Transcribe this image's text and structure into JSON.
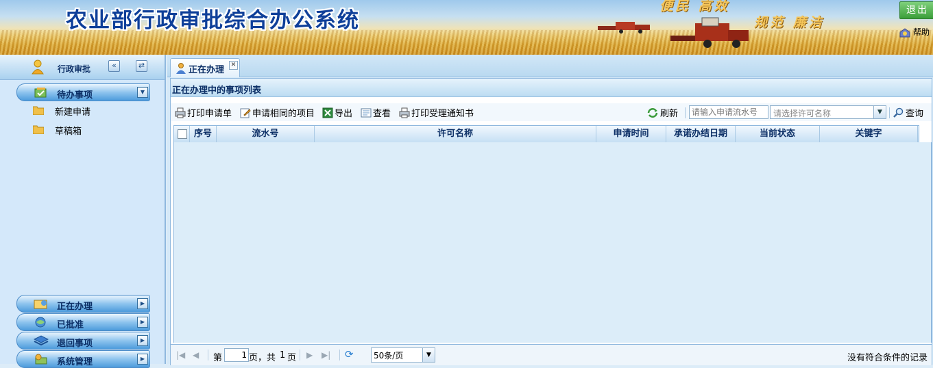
{
  "header": {
    "system_title": "农业部行政审批综合办公系统",
    "slogan_1": "便民 高效",
    "slogan_2": "规范 廉洁",
    "logout_label": "退出",
    "help_label": "帮助"
  },
  "sidebar": {
    "title": "行政审批",
    "collapse_icon": "«",
    "switch_icon": "⇄",
    "sections": [
      {
        "label": "待办事项",
        "icon": "pending-icon",
        "arrow": "▼"
      },
      {
        "label": "正在办理",
        "icon": "processing-icon",
        "arrow": "▶"
      },
      {
        "label": "已批准",
        "icon": "approved-icon",
        "arrow": "▶"
      },
      {
        "label": "退回事项",
        "icon": "returned-icon",
        "arrow": "▶"
      },
      {
        "label": "系统管理",
        "icon": "system-icon",
        "arrow": "▶"
      }
    ],
    "pending_items": [
      {
        "label": "新建申请",
        "icon": "folder-icon"
      },
      {
        "label": "草稿箱",
        "icon": "folder-icon"
      }
    ]
  },
  "main": {
    "tab": {
      "label": "正在办理",
      "close": "✕"
    },
    "panel_title": "正在办理中的事项列表",
    "toolbar": {
      "print_form": "打印申请单",
      "same_project": "申请相同的项目",
      "export": "导出",
      "view": "查看",
      "print_notice": "打印受理通知书",
      "refresh": "刷新",
      "search_placeholder": "请输入申请流水号",
      "permit_placeholder": "请选择许可名称",
      "query": "查询"
    },
    "columns": [
      "序号",
      "流水号",
      "许可名称",
      "申请时间",
      "承诺办结日期",
      "当前状态",
      "关键字"
    ],
    "pager": {
      "page_prefix": "第",
      "current_page": "1",
      "page_suffix": "页，共",
      "total_pages": "1",
      "pages_unit": "页",
      "page_size": "50条/页",
      "no_records": "没有符合条件的记录"
    }
  }
}
